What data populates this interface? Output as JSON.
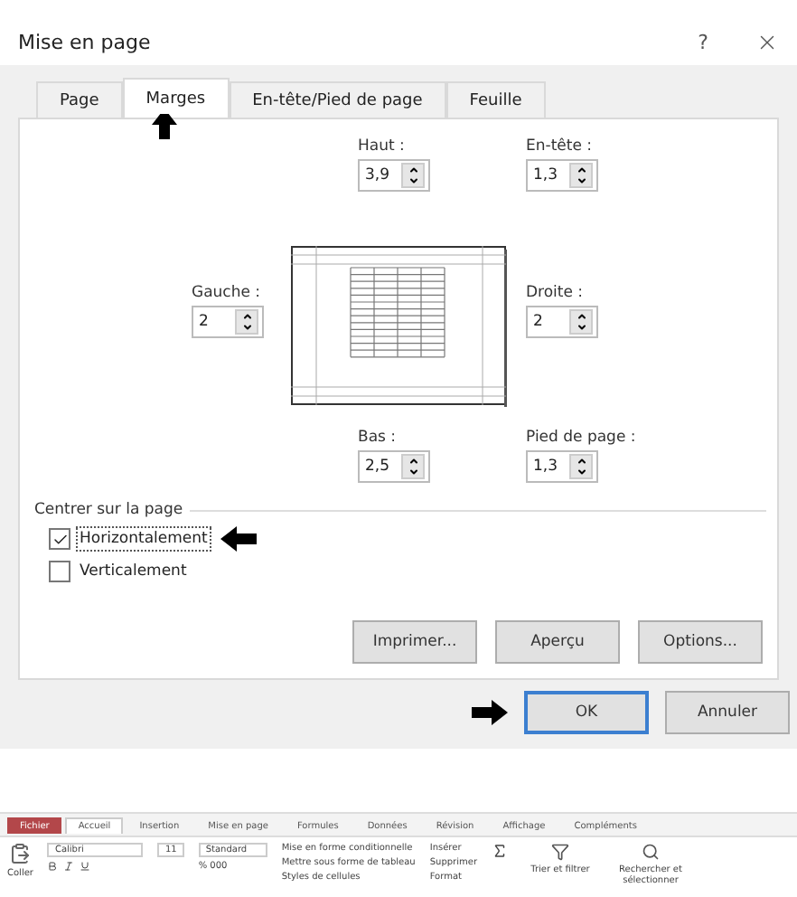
{
  "dialog": {
    "title": "Mise en page",
    "help": "?",
    "tabs": [
      {
        "label": "Page",
        "selected": false
      },
      {
        "label": "Marges",
        "selected": true
      },
      {
        "label": "En-tête/Pied de page",
        "selected": false
      },
      {
        "label": "Feuille",
        "selected": false
      }
    ],
    "margins": {
      "top": {
        "label": "Haut :",
        "value": "3,9"
      },
      "header": {
        "label": "En-tête :",
        "value": "1,3"
      },
      "left": {
        "label": "Gauche :",
        "value": "2"
      },
      "right": {
        "label": "Droite :",
        "value": "2"
      },
      "bottom": {
        "label": "Bas :",
        "value": "2,5"
      },
      "footer": {
        "label": "Pied de page :",
        "value": "1,3"
      }
    },
    "center_group": {
      "title": "Centrer sur la page",
      "options": [
        {
          "label": "Horizontalement",
          "checked": true,
          "focused": true
        },
        {
          "label": "Verticalement",
          "checked": false,
          "focused": false
        }
      ]
    },
    "panel_buttons": [
      "Imprimer...",
      "Aperçu",
      "Options..."
    ],
    "footer_buttons": [
      {
        "label": "OK",
        "default": true
      },
      {
        "label": "Annuler",
        "default": false
      }
    ]
  },
  "ribbon": {
    "tabs": [
      {
        "label": "Fichier",
        "kind": "file",
        "selected": false
      },
      {
        "label": "Accueil",
        "kind": "tab",
        "selected": true
      },
      {
        "label": "Insertion",
        "kind": "tab",
        "selected": false
      },
      {
        "label": "Mise en page",
        "kind": "tab",
        "selected": false
      },
      {
        "label": "Formules",
        "kind": "tab",
        "selected": false
      },
      {
        "label": "Données",
        "kind": "tab",
        "selected": false
      },
      {
        "label": "Révision",
        "kind": "tab",
        "selected": false
      },
      {
        "label": "Affichage",
        "kind": "tab",
        "selected": false
      },
      {
        "label": "Compléments",
        "kind": "tab",
        "selected": false
      }
    ],
    "paste": "Coller",
    "font": "Calibri",
    "size": "11",
    "number_format": "Standard",
    "number_buttons": "% 000",
    "styles": [
      "Mise en forme conditionnelle",
      "Mettre sous forme de tableau",
      "Styles de cellules"
    ],
    "cells": [
      "Insérer",
      "Supprimer",
      "Format"
    ],
    "editing": [
      {
        "label": "Trier et filtrer"
      },
      {
        "label": "Rechercher et sélectionner"
      }
    ]
  }
}
